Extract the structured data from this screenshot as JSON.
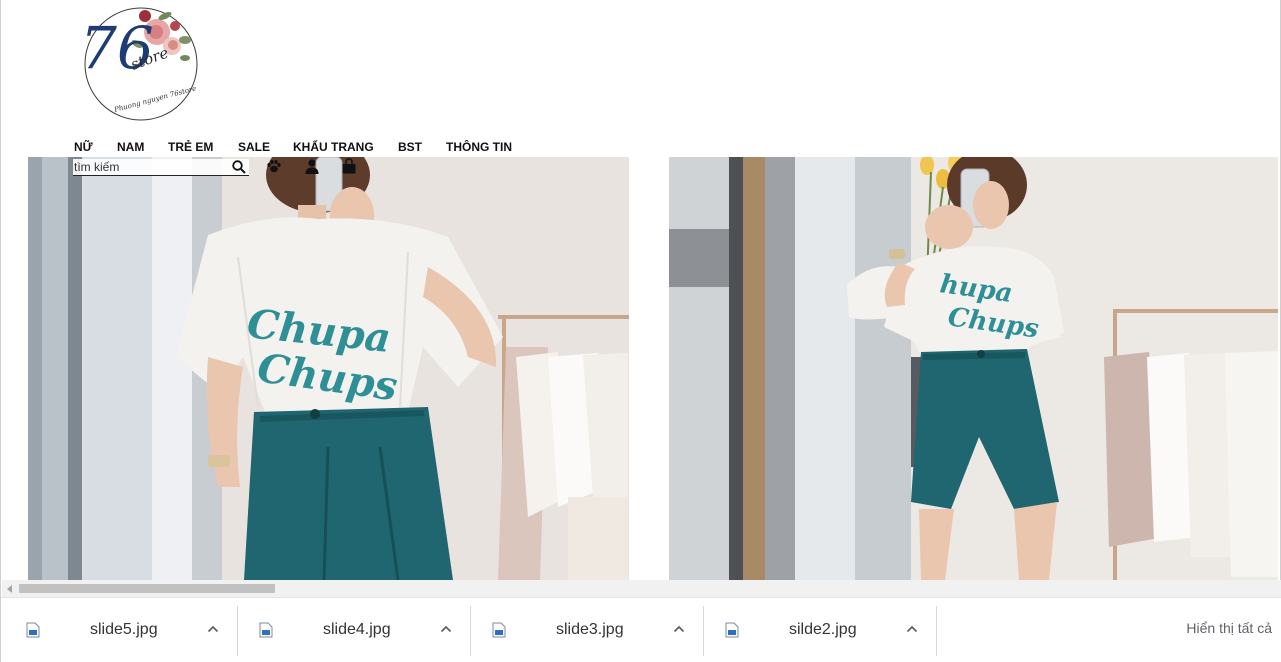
{
  "logo": {
    "text": "76 store",
    "script": "Phuong nguyen 76 store"
  },
  "nav": {
    "items": [
      {
        "label": "NỮ"
      },
      {
        "label": "NAM"
      },
      {
        "label": "TRẺ EM"
      },
      {
        "label": "SALE"
      },
      {
        "label": "KHẨU TRANG"
      },
      {
        "label": "BST"
      },
      {
        "label": "THÔNG TIN"
      }
    ]
  },
  "search": {
    "placeholder": "tìm kiếm",
    "value": ""
  },
  "icons": {
    "search": "search-icon",
    "paw": "paw-icon",
    "user": "user-icon",
    "bag": "shopping-bag-icon"
  },
  "slides": [
    {
      "name": "slide-left",
      "shirt_text": "Chupa Chups"
    },
    {
      "name": "slide-right",
      "shirt_text": "Chupa Chups"
    }
  ],
  "downloads": {
    "items": [
      {
        "name": "slide5.jpg"
      },
      {
        "name": "slide4.jpg"
      },
      {
        "name": "slide3.jpg"
      },
      {
        "name": "silde2.jpg"
      }
    ],
    "show_all": "Hiển thị tất cả"
  },
  "colors": {
    "teal_outfit": "#1f6670",
    "shirt": "#f4f2ee",
    "wall": "#ebe6e2",
    "chevron": "#5f6368"
  }
}
